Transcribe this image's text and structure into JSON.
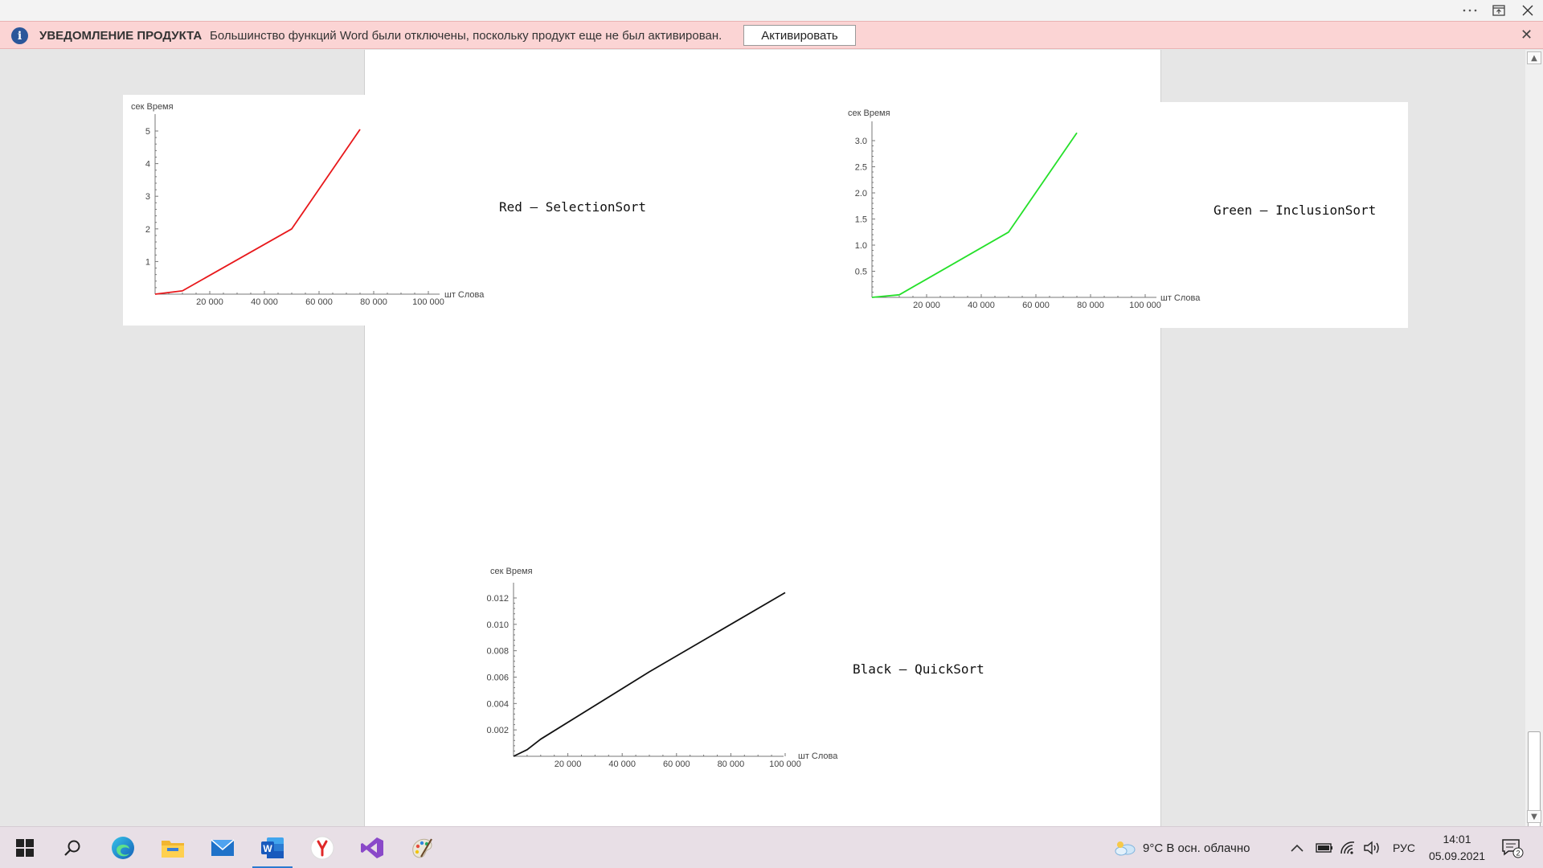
{
  "notification": {
    "title": "УВЕДОМЛЕНИЕ ПРОДУКТА",
    "message": "Большинство функций Word были отключены, поскольку продукт еще не был активирован.",
    "button": "Активировать"
  },
  "document": {
    "labels": {
      "red": "Red – SelectionSort",
      "green": "Green – InclusionSort",
      "black": "Black – QuickSort"
    }
  },
  "chart_data": [
    {
      "type": "line",
      "color": "#e8181b",
      "ylabel": "сек Время",
      "xlabel": "шт Слова",
      "x_ticks": [
        "20 000",
        "40 000",
        "60 000",
        "80 000",
        "100 000"
      ],
      "y_ticks": [
        "1",
        "2",
        "3",
        "4",
        "5"
      ],
      "xlim": [
        0,
        100000
      ],
      "ylim": [
        0,
        5
      ],
      "x": [
        0,
        10000,
        50000,
        75000
      ],
      "y": [
        0,
        0.1,
        2.0,
        5.05
      ]
    },
    {
      "type": "line",
      "color": "#25e02a",
      "ylabel": "сек Время",
      "xlabel": "шт Слова",
      "x_ticks": [
        "20 000",
        "40 000",
        "60 000",
        "80 000",
        "100 000"
      ],
      "y_ticks": [
        "0.5",
        "1.0",
        "1.5",
        "2.0",
        "2.5",
        "3.0"
      ],
      "xlim": [
        0,
        100000
      ],
      "ylim": [
        0,
        3.0
      ],
      "x": [
        0,
        10000,
        50000,
        75000
      ],
      "y": [
        0,
        0.05,
        1.25,
        3.15
      ]
    },
    {
      "type": "line",
      "color": "#111111",
      "ylabel": "сек Время",
      "xlabel": "шт Слова",
      "x_ticks": [
        "20 000",
        "40 000",
        "60 000",
        "80 000",
        "100 000"
      ],
      "y_ticks": [
        "0.002",
        "0.004",
        "0.006",
        "0.008",
        "0.010",
        "0.012"
      ],
      "xlim": [
        0,
        100000
      ],
      "ylim": [
        0,
        0.012
      ],
      "x": [
        0,
        5000,
        10000,
        50000,
        100000
      ],
      "y": [
        0,
        0.0005,
        0.0013,
        0.0064,
        0.0124
      ]
    }
  ],
  "taskbar": {
    "apps": [
      "start",
      "search",
      "edge",
      "file-explorer",
      "mail",
      "word",
      "yandex-browser",
      "visual-studio",
      "paint"
    ],
    "weather": "9°C  В осн. облачно",
    "language": "РУС",
    "time": "14:01",
    "date": "05.09.2021",
    "notifications_count": "2"
  }
}
